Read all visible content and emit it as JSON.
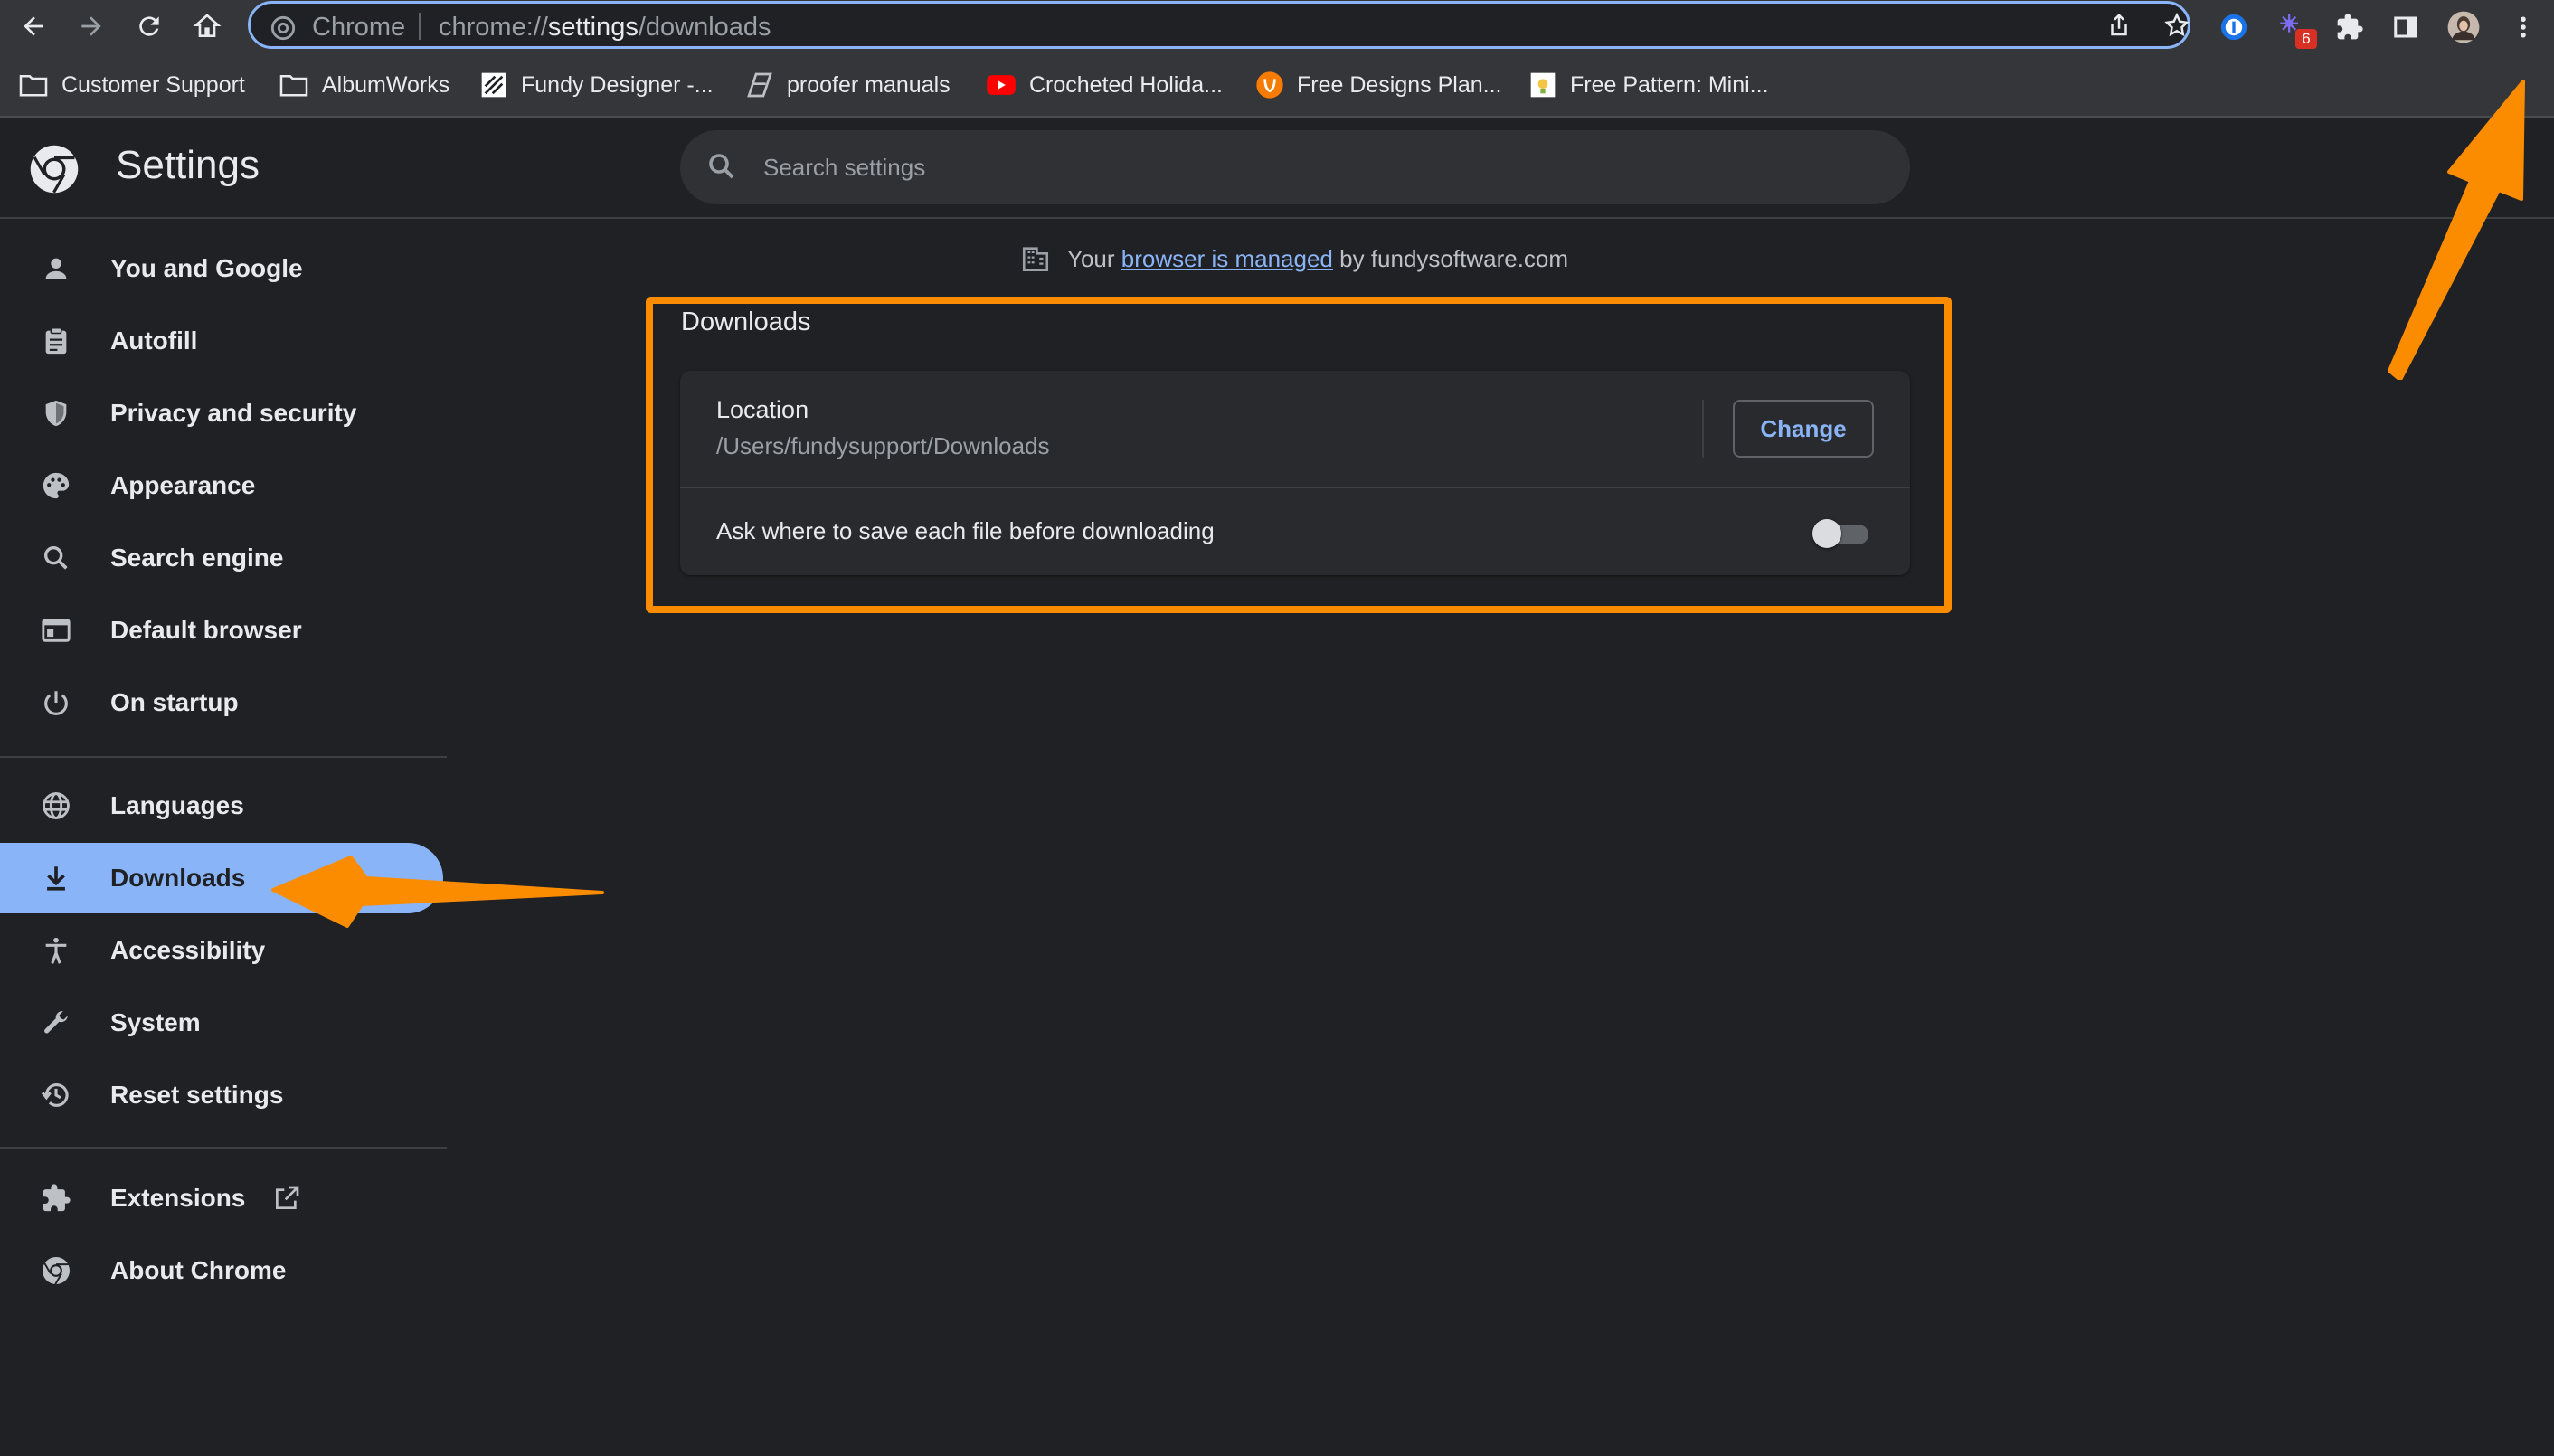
{
  "browser": {
    "omnibox": {
      "site_label": "Chrome",
      "url_prefix": "chrome://",
      "url_bold": "settings",
      "url_suffix": "/downloads"
    },
    "extension_badge": "6"
  },
  "bookmarks": [
    {
      "label": "Customer Support",
      "icon": "folder-icon"
    },
    {
      "label": "AlbumWorks",
      "icon": "folder-icon"
    },
    {
      "label": "Fundy Designer -...",
      "icon": "fundy-designer-icon"
    },
    {
      "label": "proofer manuals",
      "icon": "proofer-icon"
    },
    {
      "label": "Crocheted Holida...",
      "icon": "youtube-icon"
    },
    {
      "label": "Free Designs Plan...",
      "icon": "free-designs-icon"
    },
    {
      "label": "Free Pattern: Mini...",
      "icon": "pattern-icon"
    }
  ],
  "settings": {
    "title": "Settings",
    "search_placeholder": "Search settings"
  },
  "sidebar": {
    "items": [
      {
        "label": "You and Google",
        "icon": "person-icon"
      },
      {
        "label": "Autofill",
        "icon": "clipboard-icon"
      },
      {
        "label": "Privacy and security",
        "icon": "shield-icon"
      },
      {
        "label": "Appearance",
        "icon": "palette-icon"
      },
      {
        "label": "Search engine",
        "icon": "search-icon"
      },
      {
        "label": "Default browser",
        "icon": "browser-window-icon"
      },
      {
        "label": "On startup",
        "icon": "power-icon"
      },
      {
        "label": "Languages",
        "icon": "globe-icon"
      },
      {
        "label": "Downloads",
        "icon": "download-icon",
        "selected": true
      },
      {
        "label": "Accessibility",
        "icon": "accessibility-icon"
      },
      {
        "label": "System",
        "icon": "wrench-icon"
      },
      {
        "label": "Reset settings",
        "icon": "history-icon"
      },
      {
        "label": "Extensions",
        "icon": "puzzle-icon"
      },
      {
        "label": "About Chrome",
        "icon": "chrome-icon"
      }
    ]
  },
  "main": {
    "managed_prefix": "Your",
    "managed_link": "browser is managed",
    "managed_suffix": "by fundysoftware.com",
    "section_title": "Downloads",
    "location_label": "Location",
    "location_path": "/Users/fundysupport/Downloads",
    "change_button": "Change",
    "ask_label": "Ask where to save each file before downloading",
    "ask_toggle_on": false
  },
  "colors": {
    "accent": "#8ab4f8",
    "annotation_orange": "#fb8c00",
    "background": "#202124"
  }
}
